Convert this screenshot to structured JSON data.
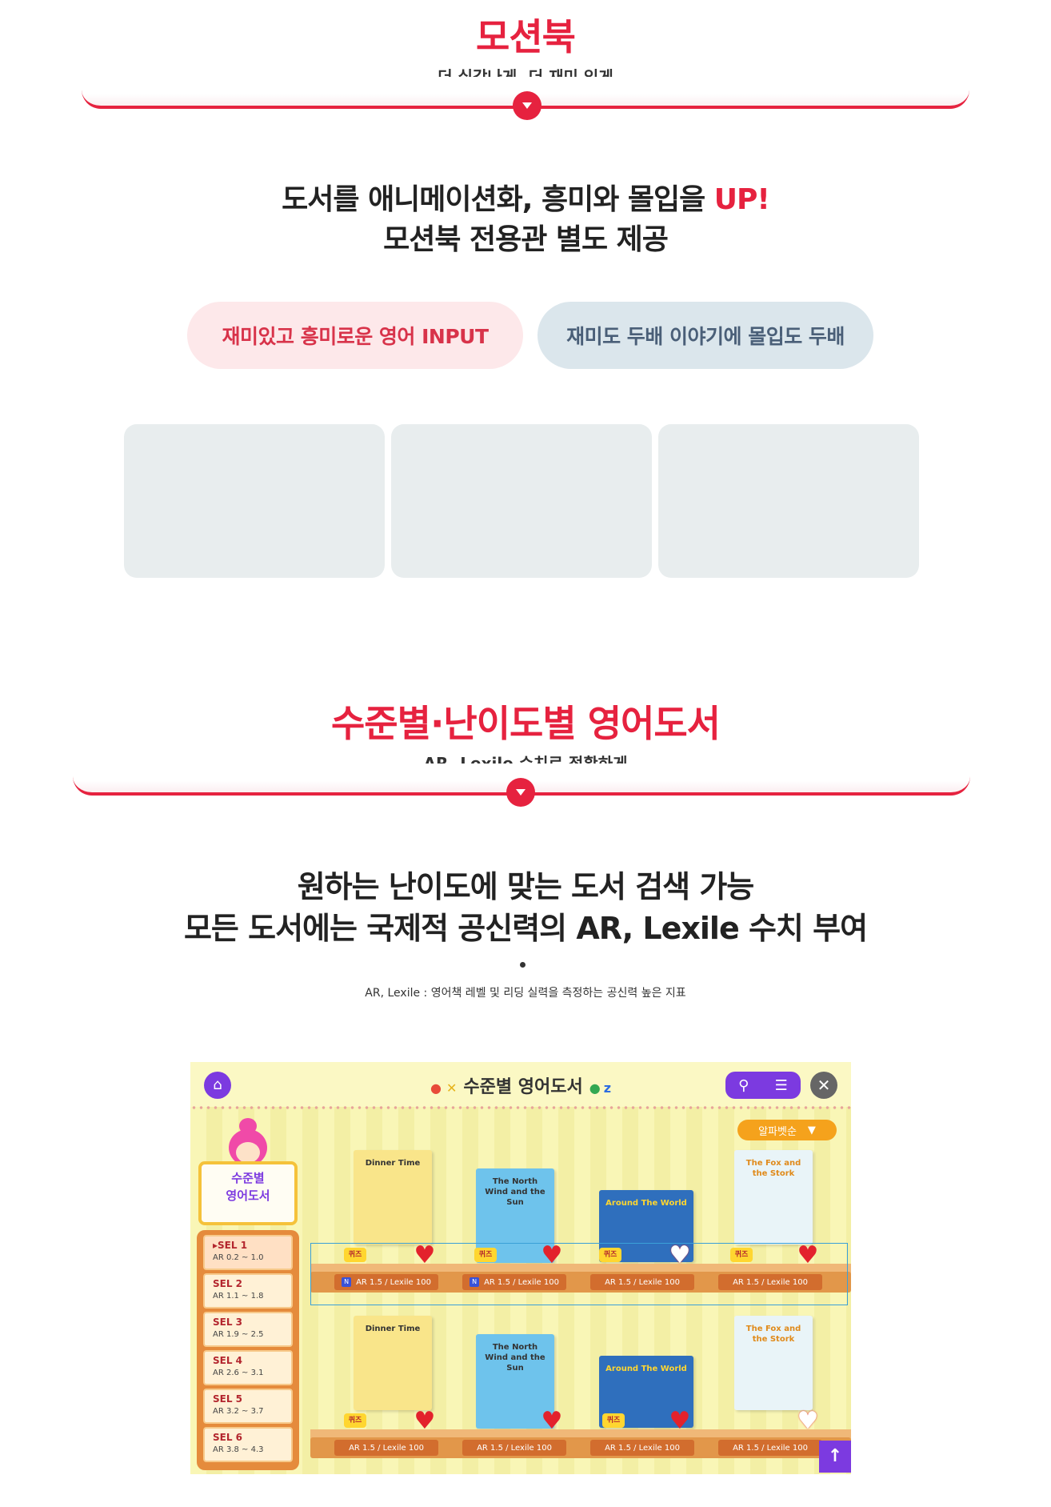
{
  "section1": {
    "title": "모션북",
    "subtitle": "더 실감나게, 더 재미 있게",
    "headline_line1": "도서를 애니메이션화, 흥미와 몰입을 ",
    "headline_accent": "UP!",
    "headline_line2": "모션북 전용관 별도 제공",
    "pill_left": "재미있고 흥미로운 영어 INPUT",
    "pill_right": "재미도 두배 이야기에 몰입도 두배"
  },
  "section2": {
    "title": "수준별·난이도별 영어도서",
    "subtitle": "AR, Lexile 수치로 정확하게",
    "headline_line1": "원하는 난이도에 맞는 도서 검색 가능",
    "headline_line2": "모든 도서에는 국제적 공신력의 AR, Lexile 수치 부여",
    "note": "AR, Lexile : 영어책 레벨 및 리딩 실력을 측정하는 공신력 높은 지표"
  },
  "app": {
    "title": "수준별 영어도서",
    "sort_label": "알파벳순",
    "sign_line1": "수준별",
    "sign_line2": "영어도서",
    "levels": [
      {
        "name": "▸SEL 1",
        "range": "AR 0.2 ~ 1.0"
      },
      {
        "name": "SEL 2",
        "range": "AR 1.1 ~ 1.8"
      },
      {
        "name": "SEL 3",
        "range": "AR 1.9 ~ 2.5"
      },
      {
        "name": "SEL 4",
        "range": "AR 2.6 ~ 3.1"
      },
      {
        "name": "SEL 5",
        "range": "AR 3.2 ~ 3.7"
      },
      {
        "name": "SEL 6",
        "range": "AR 3.8 ~ 4.3"
      }
    ],
    "books": [
      {
        "title": "Dinner Time",
        "label": "AR 1.5  / Lexile 100"
      },
      {
        "title": "The North Wind and the Sun",
        "label": "AR 1.5  / Lexile 100"
      },
      {
        "title": "Around The World",
        "label": "AR 1.5  / Lexile 100"
      },
      {
        "title": "The Fox and the Stork",
        "label": "AR 1.5  / Lexile 100"
      }
    ],
    "badge": "퀴즈",
    "new_tag": "N"
  }
}
